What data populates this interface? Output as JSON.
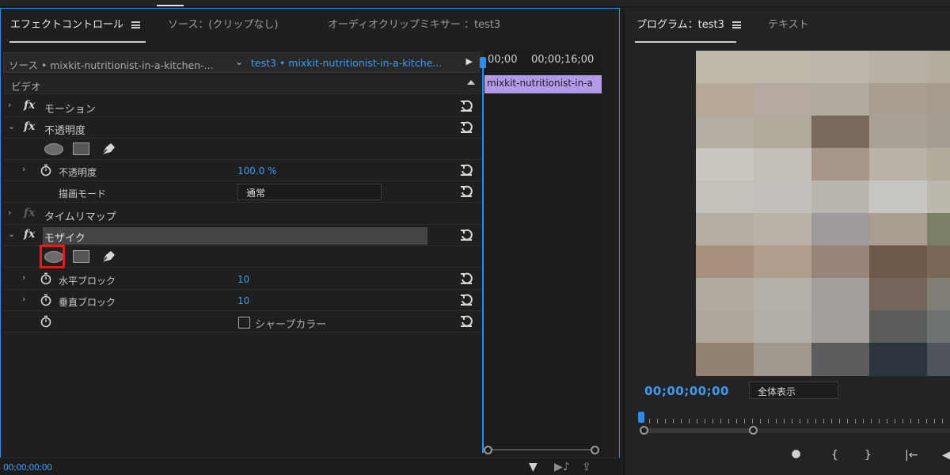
{
  "tabs": {
    "effect_controls": "エフェクトコントロール",
    "source": "ソース：(クリップなし)",
    "audio_mixer": "オーディオクリップミキサー ：test3"
  },
  "source_row": {
    "source_clip": "ソース • mixkit-nutritionist-in-a-kitchen-...",
    "sequence_clip": "test3 • mixkit-nutritionist-in-a-kitche..."
  },
  "section_header": "ビデオ",
  "effects": {
    "motion": "モーション",
    "opacity": "不透明度",
    "opacity_prop": "不透明度",
    "opacity_value": "100.0 %",
    "blend_mode_label": "描画モード",
    "blend_mode_value": "通常",
    "time_remap": "タイムリマップ",
    "mosaic": "モザイク",
    "h_blocks_label": "水平ブロック",
    "h_blocks_value": "10",
    "v_blocks_label": "垂直ブロック",
    "v_blocks_value": "10",
    "sharp_color_label": "シャープカラー"
  },
  "timeline": {
    "time_start": "00;00",
    "time_mid": "00;00;16;00",
    "clip_name": "mixkit-nutritionist-in-a"
  },
  "bottom_timecode": "00;00;00;00",
  "program": {
    "title": "プログラム：test3",
    "text_tab": "テキスト",
    "timecode": "00;00;00;00",
    "fit": "全体表示"
  },
  "colors": {
    "accent_blue": "#2d8ceb",
    "value_blue": "#3d9bf2",
    "clip_purple": "#b19be8",
    "highlight_red": "#e31b1b"
  },
  "mosaic_colors": [
    [
      "#c0b8aa",
      "#c0b8ab",
      "#bdb6aa",
      "#b8b0a4",
      "#b2ad9c"
    ],
    [
      "#b6a897",
      "#b5aa9f",
      "#b0aa9f",
      "#a99e91",
      "#a69d8e"
    ],
    [
      "#b4ada2",
      "#b0a99c",
      "#7a6a5c",
      "#a9a096",
      "#a49d93"
    ],
    [
      "#cac6c0",
      "#c4bfb8",
      "#a8958a",
      "#bab2a9",
      "#b1ab9c"
    ],
    [
      "#c4c1bb",
      "#c2bfba",
      "#bab5ae",
      "#c7c6c2",
      "#bdb8ae"
    ],
    [
      "#b4ada3",
      "#b8b2a8",
      "#9f9a99",
      "#a99c90",
      "#7a8068"
    ],
    [
      "#a7917c",
      "#b09d8b",
      "#988577",
      "#6f5a4a",
      "#7b6757"
    ],
    [
      "#b3aa9f",
      "#b4afa8",
      "#a39f9a",
      "#73655c",
      "#807d75"
    ],
    [
      "#afa79c",
      "#b2aea6",
      "#a3a09b",
      "#5b5d5b",
      "#6e7270"
    ],
    [
      "#928272",
      "#9f998e",
      "#5b5d5d",
      "#2c353d",
      "#4e5459"
    ]
  ]
}
